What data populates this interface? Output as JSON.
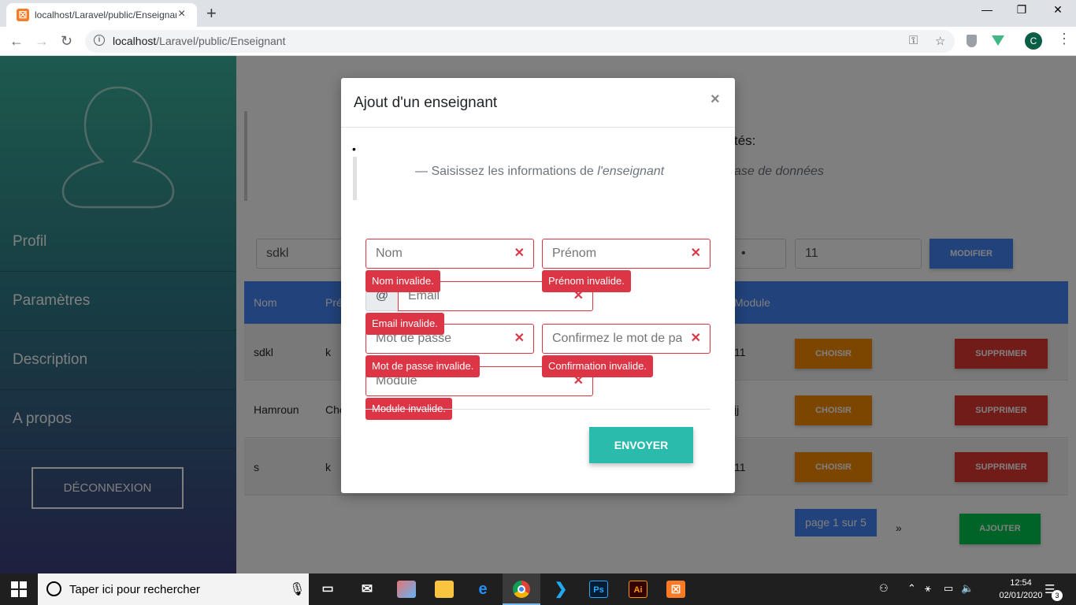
{
  "browser": {
    "tab_title": "localhost/Laravel/public/Enseignant",
    "tab_close": "×",
    "new_tab": "+",
    "url_host": "localhost",
    "url_path": "/Laravel/public/Enseignant",
    "avatar_letter": "C",
    "window_controls": {
      "minimize": "—",
      "restore": "❐",
      "close": "✕"
    },
    "favicon_letter": "☒"
  },
  "sidebar": {
    "items": [
      {
        "label": "Profil"
      },
      {
        "label": "Paramètres"
      },
      {
        "label": "Description"
      },
      {
        "label": "A propos"
      }
    ],
    "logout_label": "DÉCONNEXION"
  },
  "main": {
    "title_partial": "tés:",
    "subtitle_partial": "ase de données",
    "edit_row": {
      "nom_value": "sdkl",
      "password_value": "•",
      "module_value": "11"
    },
    "modify_label": "MODIFIER",
    "table": {
      "headers": [
        "Nom",
        "Pré",
        "Module"
      ],
      "rows": [
        {
          "nom": "sdkl",
          "prenom": "k",
          "module": "11"
        },
        {
          "nom": "Hamroun",
          "prenom": "Che",
          "module": "jj"
        },
        {
          "nom": "s",
          "prenom": "k",
          "module": "11"
        }
      ],
      "choose_label": "CHOISIR",
      "delete_label": "SUPPRIMER"
    },
    "pagination": {
      "info": "page 1 sur 5",
      "next": "»"
    },
    "add_label": "AJOUTER"
  },
  "modal": {
    "title": "Ajout d'un enseignant",
    "close": "×",
    "bullet": "•",
    "quote_prefix": "— Saisissez les informations de ",
    "quote_em": "l'enseignant",
    "fields": {
      "nom": {
        "placeholder": "Nom",
        "error": "Nom invalide."
      },
      "prenom": {
        "placeholder": "Prénom",
        "error": "Prénom invalide."
      },
      "email": {
        "prefix": "@",
        "placeholder": "Email",
        "error": "Email invalide."
      },
      "password": {
        "placeholder": "Mot de passe",
        "error": "Mot de passe invalide."
      },
      "confirm": {
        "placeholder": "Confirmez le mot de passe",
        "error": "Confirmation invalide."
      },
      "module": {
        "placeholder": "Module",
        "error": "Module invalide."
      }
    },
    "error_mark": "✕",
    "submit_label": "ENVOYER"
  },
  "taskbar": {
    "search_placeholder": "Taper ici pour rechercher",
    "apps": [
      "task-view",
      "mail",
      "paint",
      "file-explorer",
      "edge",
      "chrome",
      "vscode",
      "photoshop",
      "illustrator",
      "xampp"
    ],
    "app_labels": {
      "photoshop": "Ps",
      "illustrator": "Ai"
    },
    "time": "12:54",
    "date": "02/01/2020",
    "notifications": "3"
  },
  "colors": {
    "primary": "#4285f4",
    "danger": "#dc3545",
    "warning": "#fb8c00",
    "success": "#00c851",
    "teal": "#2bbbad"
  }
}
